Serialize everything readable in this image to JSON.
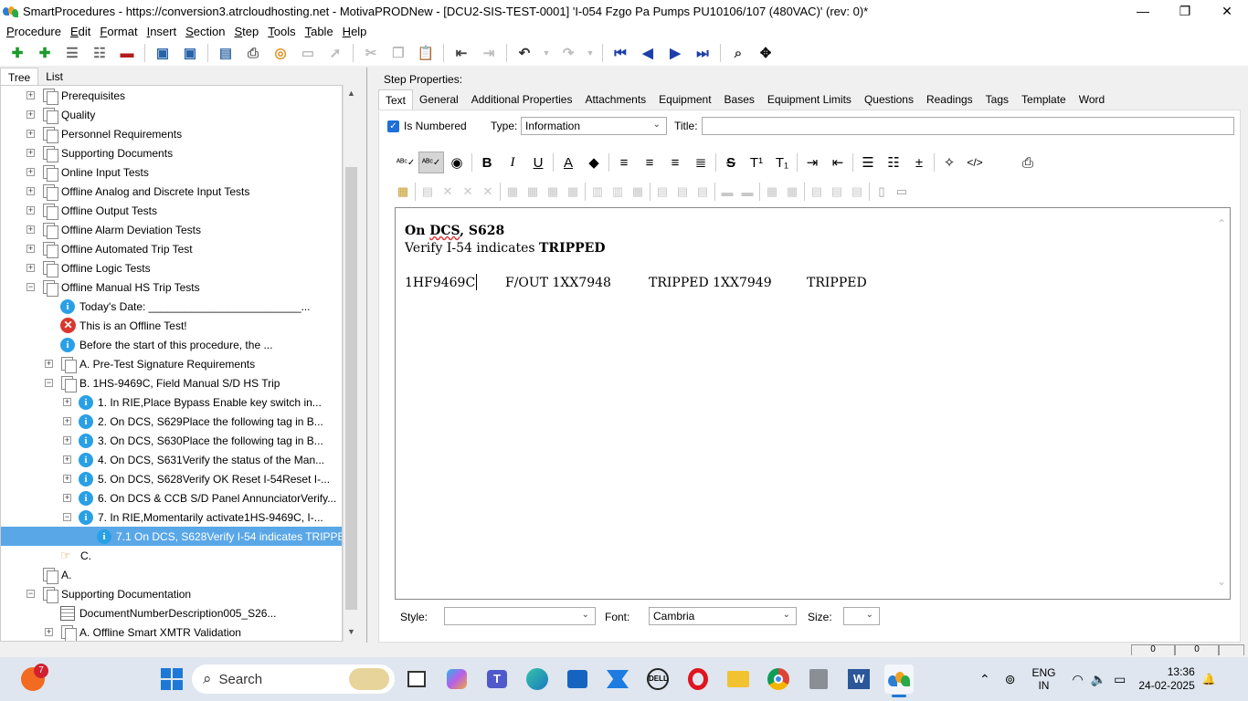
{
  "window": {
    "title": "SmartProcedures - https://conversion3.atrcloudhosting.net - MotivaPRODNew - [DCU2-SIS-TEST-0001] 'I-054 Fzgo Pa Pumps PU10106/107 (480VAC)' (rev: 0)*",
    "minimize": "—",
    "maximize": "❐",
    "close": "✕"
  },
  "menu": [
    {
      "first": "P",
      "rest": "rocedure"
    },
    {
      "first": "E",
      "rest": "dit"
    },
    {
      "first": "F",
      "rest": "ormat"
    },
    {
      "first": "I",
      "rest": "nsert"
    },
    {
      "first": "S",
      "rest": "ection"
    },
    {
      "first": "S",
      "rest": "tep"
    },
    {
      "first": "T",
      "rest": "ools"
    },
    {
      "first": "T",
      "rest": "able"
    },
    {
      "first": "H",
      "rest": "elp"
    }
  ],
  "left_tabs": {
    "tree": "Tree",
    "list": "List"
  },
  "tree": [
    {
      "label": "Prerequisites"
    },
    {
      "label": "Quality"
    },
    {
      "label": "Personnel Requirements"
    },
    {
      "label": "Supporting Documents"
    },
    {
      "label": "Online Input Tests"
    },
    {
      "label": "Offline Analog and Discrete Input Tests"
    },
    {
      "label": "Offline Output Tests"
    },
    {
      "label": "Offline Alarm Deviation Tests"
    },
    {
      "label": "Offline Automated Trip Test"
    },
    {
      "label": "Offline Logic Tests"
    },
    {
      "label": "Offline Manual HS Trip Tests"
    },
    {
      "label": "Today's Date: _________________________..."
    },
    {
      "label": "This is an Offline Test!"
    },
    {
      "label": "Before the start of this procedure, the ..."
    },
    {
      "label": "A. Pre-Test Signature Requirements"
    },
    {
      "label": "B. 1HS-9469C, Field Manual S/D HS Trip"
    },
    {
      "label": "1. In RIE,Place Bypass Enable key switch in..."
    },
    {
      "label": "2. On DCS, S629Place the following tag in B..."
    },
    {
      "label": "3. On DCS, S630Place the following tag in B..."
    },
    {
      "label": "4. On DCS, S631Verify the status of the Man..."
    },
    {
      "label": "5. On DCS, S628Verify OK Reset I-54Reset I-..."
    },
    {
      "label": "6. On DCS & CCB S/D Panel AnnunciatorVerify..."
    },
    {
      "label": "7. In RIE,Momentarily activate1HS-9469C, I-..."
    },
    {
      "label": "7.1 On DCS, S628Verify I-54 indicates TRIPPE..."
    },
    {
      "label": "C."
    },
    {
      "label": "A."
    },
    {
      "label": "Supporting Documentation"
    },
    {
      "label": "DocumentNumberDescription005_S26..."
    },
    {
      "label": "A. Offline Smart XMTR Validation"
    }
  ],
  "step_properties_label": "Step Properties:",
  "tabs": [
    "Text",
    "General",
    "Additional Properties",
    "Attachments",
    "Equipment",
    "Bases",
    "Equipment Limits",
    "Questions",
    "Readings",
    "Tags",
    "Template",
    "Word"
  ],
  "is_numbered_label": "Is Numbered",
  "type_label": "Type:",
  "type_value": "Information",
  "title_label": "Title:",
  "title_value": "",
  "editor": {
    "line1_bold1": "On ",
    "line1_squiggle": "DCS",
    "line1_bold2": ", S628",
    "line2_normal": "Verify I-54 indicates ",
    "line2_bold": "TRIPPED",
    "table_cells": [
      "1HF9469C",
      "F/OUT 1XX7948",
      "TRIPPED 1XX7949",
      "TRIPPED"
    ]
  },
  "style_label": "Style:",
  "style_value": "",
  "font_label": "Font:",
  "font_value": "Cambria",
  "size_label": "Size:",
  "size_value": "",
  "status_strip": [
    "0",
    "0"
  ],
  "taskbar": {
    "search_placeholder": "Search",
    "badge": "7",
    "lang1": "ENG",
    "lang2": "IN",
    "time": "13:36",
    "date": "24-02-2025"
  }
}
